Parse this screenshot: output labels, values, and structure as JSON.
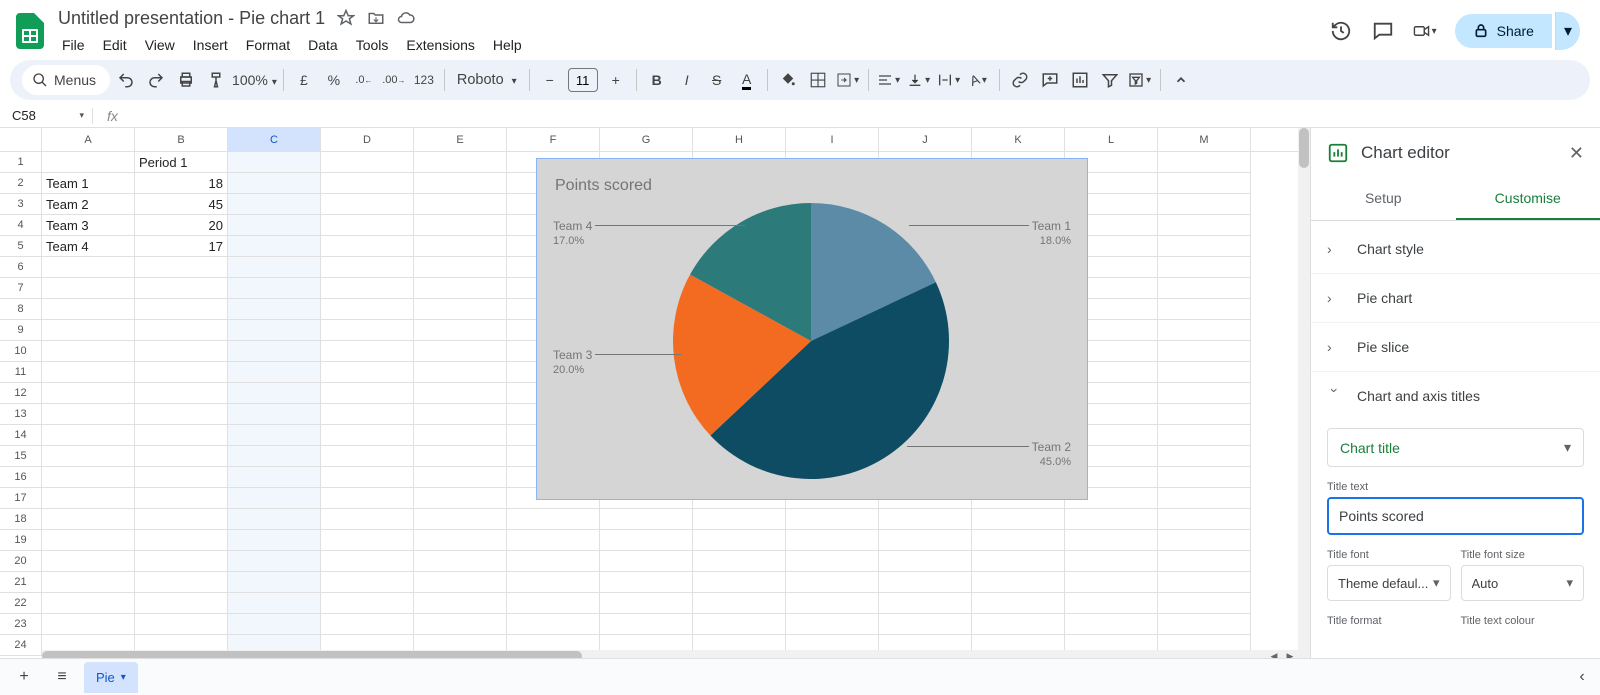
{
  "doc_title": "Untitled presentation - Pie chart 1",
  "menus": [
    "File",
    "Edit",
    "View",
    "Insert",
    "Format",
    "Data",
    "Tools",
    "Extensions",
    "Help"
  ],
  "toolbar": {
    "menus_label": "Menus",
    "zoom": "100%",
    "font": "Roboto",
    "font_size": "11"
  },
  "share_label": "Share",
  "name_box": "C58",
  "columns": [
    "A",
    "B",
    "C",
    "D",
    "E",
    "F",
    "G",
    "H",
    "I",
    "J",
    "K",
    "L",
    "M"
  ],
  "rows_count": 24,
  "sheet_data": {
    "header": [
      "",
      "Period 1"
    ],
    "rows": [
      [
        "Team 1",
        "18"
      ],
      [
        "Team 2",
        "45"
      ],
      [
        "Team 3",
        "20"
      ],
      [
        "Team 4",
        "17"
      ]
    ]
  },
  "chart_data": {
    "type": "pie",
    "title": "Points scored",
    "series": [
      {
        "name": "Team 1",
        "value": 18,
        "pct": "18.0%",
        "color": "#5b8ba7"
      },
      {
        "name": "Team 2",
        "value": 45,
        "pct": "45.0%",
        "color": "#0d4c63"
      },
      {
        "name": "Team 3",
        "value": 20,
        "pct": "20.0%",
        "color": "#f36b21"
      },
      {
        "name": "Team 4",
        "value": 17,
        "pct": "17.0%",
        "color": "#2d7a7a"
      }
    ]
  },
  "sidebar": {
    "title": "Chart editor",
    "tabs": {
      "setup": "Setup",
      "customise": "Customise"
    },
    "sections": {
      "chart_style": "Chart style",
      "pie_chart": "Pie chart",
      "pie_slice": "Pie slice",
      "chart_axis_titles": "Chart and axis titles"
    },
    "title_select": "Chart title",
    "title_text_label": "Title text",
    "title_text_value": "Points scored",
    "title_font_label": "Title font",
    "title_font_value": "Theme defaul...",
    "title_fontsize_label": "Title font size",
    "title_fontsize_value": "Auto",
    "title_format_label": "Title format",
    "title_colour_label": "Title text colour"
  },
  "sheet_tab": "Pie"
}
